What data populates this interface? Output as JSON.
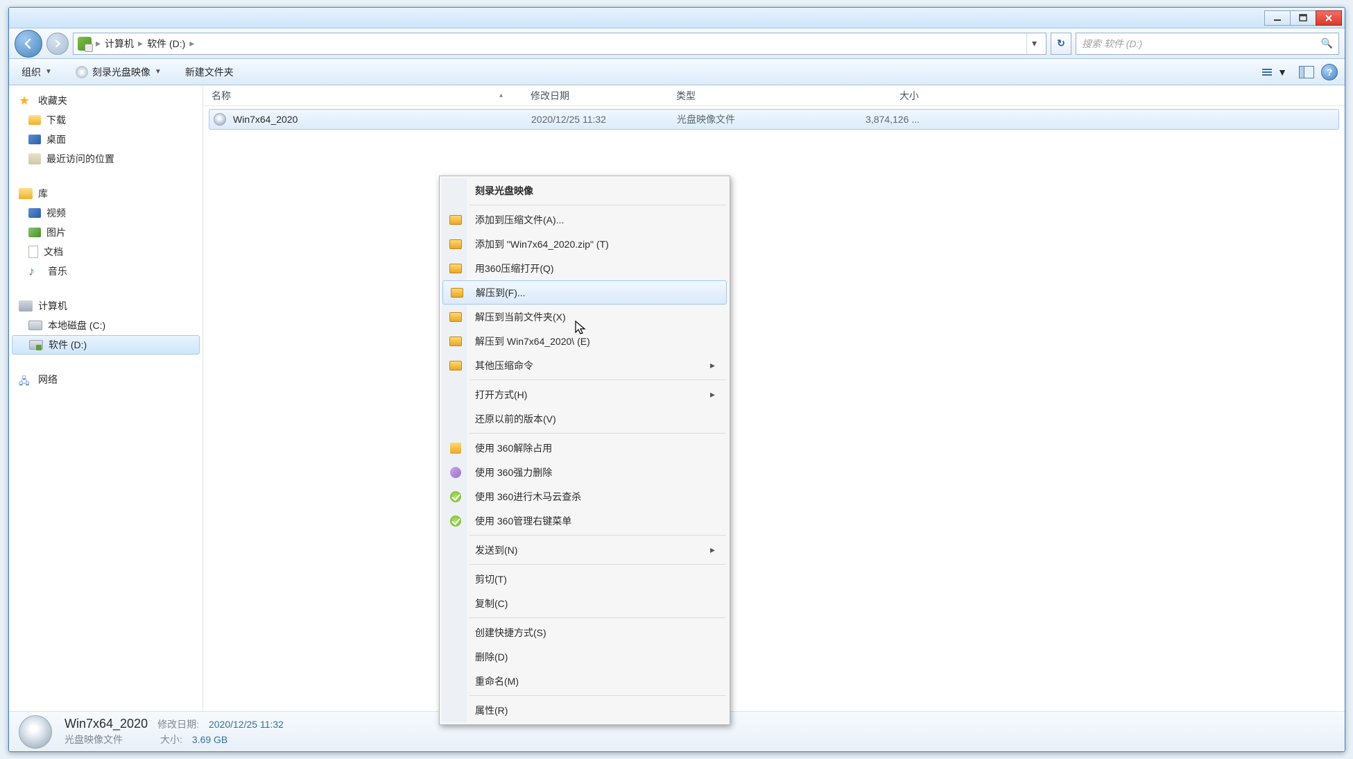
{
  "breadcrumb": {
    "root": "计算机",
    "leaf": "软件 (D:)"
  },
  "search": {
    "placeholder": "搜索 软件 (D:)"
  },
  "toolbar": {
    "organize": "组织",
    "burn": "刻录光盘映像",
    "newfolder": "新建文件夹"
  },
  "sidebar": {
    "favorites": "收藏夹",
    "downloads": "下载",
    "desktop": "桌面",
    "recent": "最近访问的位置",
    "libraries": "库",
    "videos": "视频",
    "pictures": "图片",
    "documents": "文档",
    "music": "音乐",
    "computer": "计算机",
    "cdrive": "本地磁盘 (C:)",
    "ddrive": "软件 (D:)",
    "network": "网络"
  },
  "columns": {
    "name": "名称",
    "date": "修改日期",
    "type": "类型",
    "size": "大小"
  },
  "file": {
    "name": "Win7x64_2020",
    "date": "2020/12/25 11:32",
    "type": "光盘映像文件",
    "size": "3,874,126 ..."
  },
  "context": {
    "burn": "刻录光盘映像",
    "add_archive": "添加到压缩文件(A)...",
    "add_zip": "添加到 \"Win7x64_2020.zip\" (T)",
    "open_360zip": "用360压缩打开(Q)",
    "extract_to": "解压到(F)...",
    "extract_here": "解压到当前文件夹(X)",
    "extract_folder": "解压到 Win7x64_2020\\ (E)",
    "other_zip": "其他压缩命令",
    "open_with": "打开方式(H)",
    "restore": "还原以前的版本(V)",
    "unlock360": "使用 360解除占用",
    "forcedel360": "使用 360强力删除",
    "scan360": "使用 360进行木马云查杀",
    "menu360": "使用 360管理右键菜单",
    "sendto": "发送到(N)",
    "cut": "剪切(T)",
    "copy": "复制(C)",
    "shortcut": "创建快捷方式(S)",
    "delete": "删除(D)",
    "rename": "重命名(M)",
    "props": "属性(R)"
  },
  "status": {
    "title": "Win7x64_2020",
    "date_lbl": "修改日期:",
    "date_val": "2020/12/25 11:32",
    "type": "光盘映像文件",
    "size_lbl": "大小:",
    "size_val": "3.69 GB"
  }
}
